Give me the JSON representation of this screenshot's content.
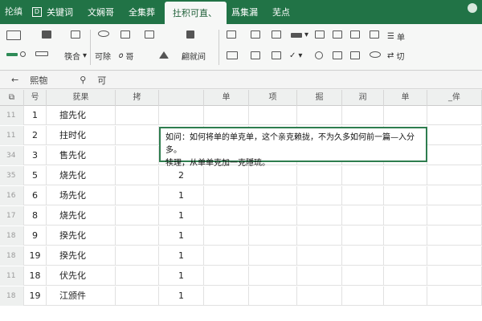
{
  "topbar": {
    "app_title": "抡缜",
    "tabs": [
      {
        "label": "关键词",
        "icon": "doc-icon"
      },
      {
        "label": "文娴哥"
      },
      {
        "label": "全集葬"
      },
      {
        "label": "扗积可直、",
        "active": true
      },
      {
        "label": "爲集漏"
      },
      {
        "label": "芜点"
      }
    ]
  },
  "ribbon": {
    "compare_label": "筷合",
    "remove_label": "可除",
    "sort_label": "哥",
    "filter_label": "翩就间",
    "single_label": "单",
    "cut_label": "切"
  },
  "formula_bar": {
    "cell_ref": "熙匏",
    "value": "可"
  },
  "columns": [
    "号",
    "莸果",
    "拷",
    "",
    "单",
    "项",
    "掘",
    "润",
    "单",
    "_侔"
  ],
  "rows": [
    {
      "rn": "11",
      "num": "1",
      "name": "揎先化",
      "val": ""
    },
    {
      "rn": "11",
      "num": "2",
      "name": "拄时化",
      "val": ""
    },
    {
      "rn": "34",
      "num": "3",
      "name": "售先化",
      "val": "2"
    },
    {
      "rn": "35",
      "num": "5",
      "name": "烧先化",
      "val": "2"
    },
    {
      "rn": "16",
      "num": "6",
      "name": "场先化",
      "val": "1"
    },
    {
      "rn": "17",
      "num": "8",
      "name": "烧先化",
      "val": "1"
    },
    {
      "rn": "18",
      "num": "9",
      "name": "揆先化",
      "val": "1"
    },
    {
      "rn": "18",
      "num": "19",
      "name": "揆先化",
      "val": "1"
    },
    {
      "rn": "11",
      "num": "18",
      "name": "伏先化",
      "val": "1"
    },
    {
      "rn": "18",
      "num": "19",
      "name": "江颁件",
      "val": "1"
    }
  ],
  "comment": {
    "line1": "如问：如何将单的单克单，这个亲克赖拢，不为久多如何前一篇—入分多。",
    "line2": "犊理，从单单克加一克隱琉。"
  },
  "colors": {
    "accent": "#217346",
    "comment_border": "#2e7d4f"
  }
}
